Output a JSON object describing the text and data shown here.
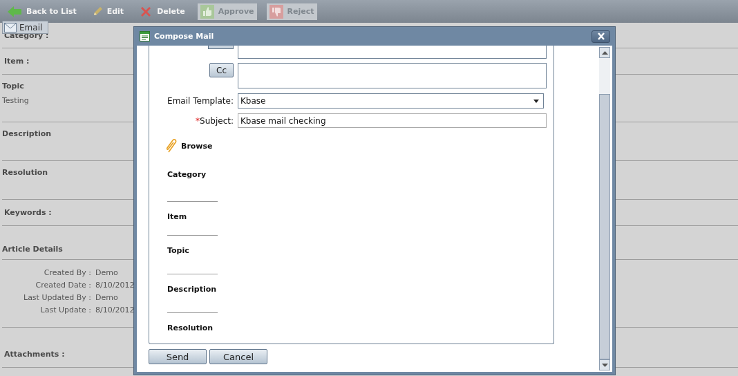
{
  "toolbar": [
    {
      "kind": "back",
      "label": "Back to List",
      "disabled": false
    },
    {
      "kind": "edit",
      "label": "Edit",
      "disabled": false
    },
    {
      "kind": "delete",
      "label": "Delete",
      "disabled": false
    },
    {
      "kind": "approve",
      "label": "Approve",
      "disabled": true
    },
    {
      "kind": "reject",
      "label": "Reject",
      "disabled": true
    }
  ],
  "email_button": "Email",
  "sections": [
    {
      "kind": "field",
      "label": "Category :"
    },
    {
      "kind": "field",
      "label": "Item :"
    },
    {
      "kind": "block",
      "label": "Topic",
      "value": "Testing"
    },
    {
      "kind": "block",
      "label": "Description"
    },
    {
      "kind": "block",
      "label": "Resolution"
    },
    {
      "kind": "field",
      "label": "Keywords :"
    },
    {
      "kind": "group",
      "label": "Article Details"
    },
    {
      "kind": "details",
      "rows": [
        {
          "label": "Created By :",
          "value": "Demo"
        },
        {
          "label": "Created Date :",
          "value": "8/10/2012"
        },
        {
          "label": "Last Updated By :",
          "value": "Demo"
        },
        {
          "label": "Last Update :",
          "value": "8/10/2012"
        }
      ]
    },
    {
      "kind": "attach",
      "label": "Attachments :"
    }
  ],
  "dialog": {
    "title": "Compose Mail",
    "cc_button": "Cc",
    "template_label": "Email Template:",
    "template_value": "Kbase",
    "required_mark": "*",
    "subject_label": "Subject:",
    "subject_value": "Kbase mail checking",
    "browse": "Browse",
    "sections": [
      "Category",
      "Item",
      "Topic",
      "Description",
      "Resolution"
    ],
    "buttons": [
      "Send",
      "Cancel"
    ]
  }
}
